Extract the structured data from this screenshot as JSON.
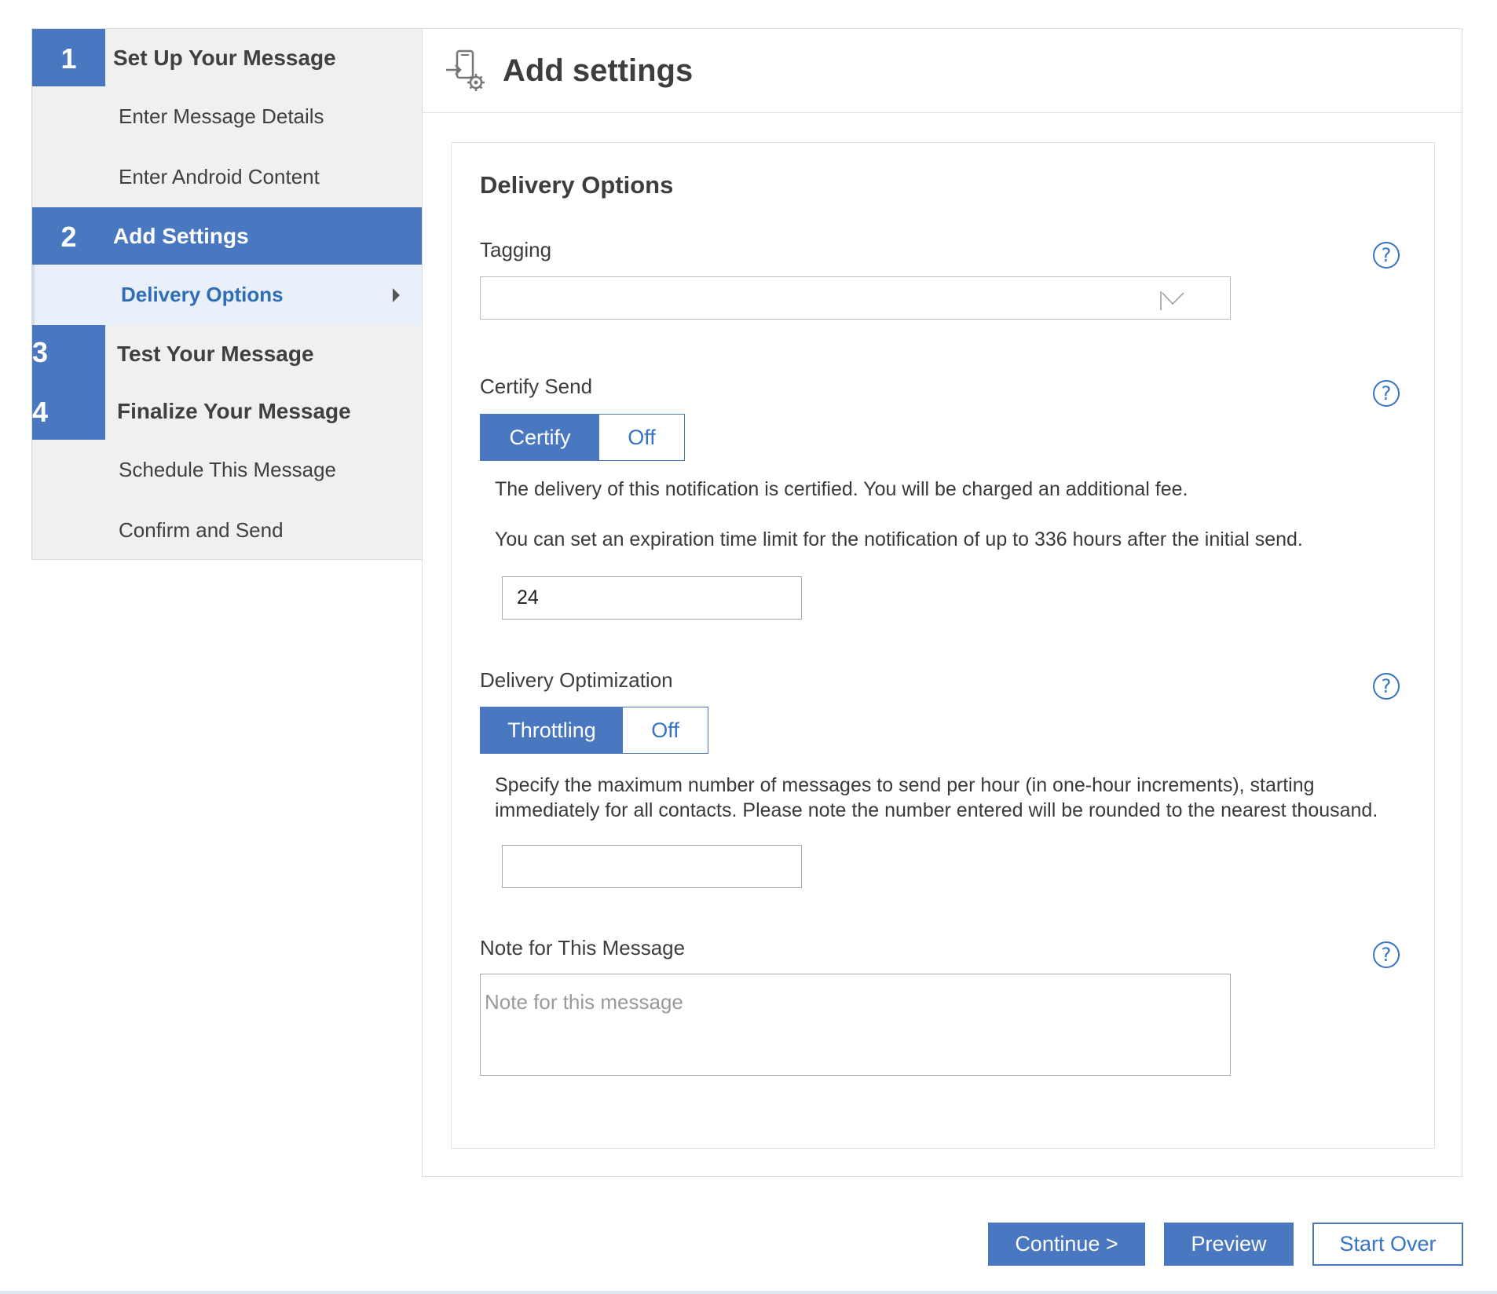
{
  "sidebar": {
    "steps": [
      {
        "number": "1",
        "label": "Set Up Your Message"
      },
      {
        "number": "2",
        "label": "Add Settings"
      },
      {
        "number": "3",
        "label": "Test Your Message"
      },
      {
        "number": "4",
        "label": "Finalize Your Message"
      }
    ],
    "substeps": {
      "enter_message_details": "Enter Message Details",
      "enter_android_content": "Enter Android Content",
      "delivery_options": "Delivery Options",
      "schedule_this_message": "Schedule This Message",
      "confirm_and_send": "Confirm and Send"
    }
  },
  "main": {
    "title": "Add settings",
    "section_title": "Delivery Options",
    "tagging": {
      "label": "Tagging",
      "value": ""
    },
    "certify_send": {
      "label": "Certify Send",
      "on_label": "Certify",
      "off_label": "Off",
      "description": "The delivery of this notification is certified. You will be charged an additional fee.",
      "expiration_text": "You can set an expiration time limit for the notification of up to 336 hours after the initial send.",
      "expiration_value": "24"
    },
    "delivery_optimization": {
      "label": "Delivery Optimization",
      "on_label": "Throttling",
      "off_label": "Off",
      "description": "Specify the maximum number of messages to send per hour (in one-hour increments), starting immediately for all contacts. Please note the number entered will be rounded to the nearest thousand.",
      "value": ""
    },
    "note": {
      "label": "Note for This Message",
      "placeholder": "Note for this message"
    },
    "help_glyph": "?"
  },
  "buttons": {
    "continue": "Continue >",
    "preview": "Preview",
    "start_over": "Start Over"
  },
  "colors": {
    "accent": "#4a78c0",
    "link": "#3573c4",
    "sidebar_bg": "#f0f0f0"
  }
}
